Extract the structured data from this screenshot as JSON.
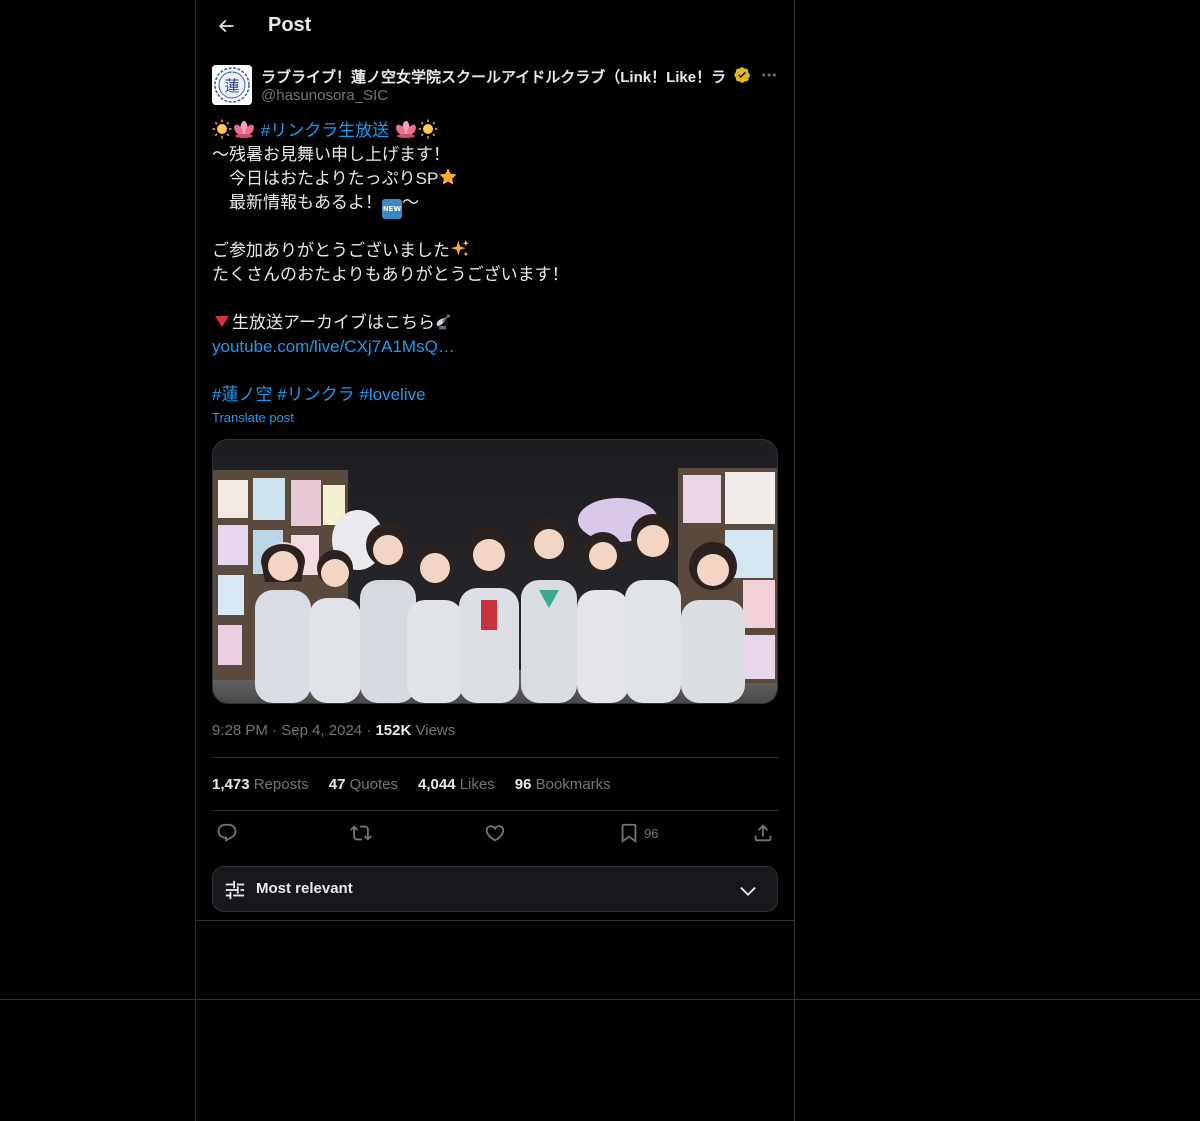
{
  "header": {
    "title": "Post"
  },
  "author": {
    "display_name": "ラブライブ！蓮ノ空女学院スクールアイドルクラブ（Link！Like！ラ",
    "handle": "@hasunosora_SIC",
    "avatar_text": "蓮"
  },
  "post": {
    "line1_hashtag": "#リンクラ生放送",
    "line2": "〜残暑お見舞い申し上げます！",
    "line3": "　今日はおたよりたっぷりSP",
    "line4": "　最新情報もあるよ！",
    "line4_tail": "〜",
    "new_badge": "NEW",
    "line6": "ご参加ありがとうございました",
    "line7": "たくさんのおたよりもありがとうございます！",
    "line9": "生放送アーカイブはこちら",
    "link": "youtube.com/live/CXj7A1MsQ…",
    "hashtags": [
      "#蓮ノ空",
      "#リンクラ",
      "#lovelive"
    ],
    "translate": "Translate post"
  },
  "meta": {
    "time": "9:28 PM",
    "date": "Sep 4, 2024",
    "views_count": "152K",
    "views_label": "Views"
  },
  "stats": {
    "reposts_count": "1,473",
    "reposts_label": "Reposts",
    "quotes_count": "47",
    "quotes_label": "Quotes",
    "likes_count": "4,044",
    "likes_label": "Likes",
    "bookmarks_count": "96",
    "bookmarks_label": "Bookmarks"
  },
  "actions": {
    "bookmark_count": "96"
  },
  "sort": {
    "label": "Most relevant"
  },
  "colors": {
    "link": "#1d9bf0",
    "verified": "#e2b719",
    "muted": "#71767b",
    "divider": "#2f3336"
  }
}
